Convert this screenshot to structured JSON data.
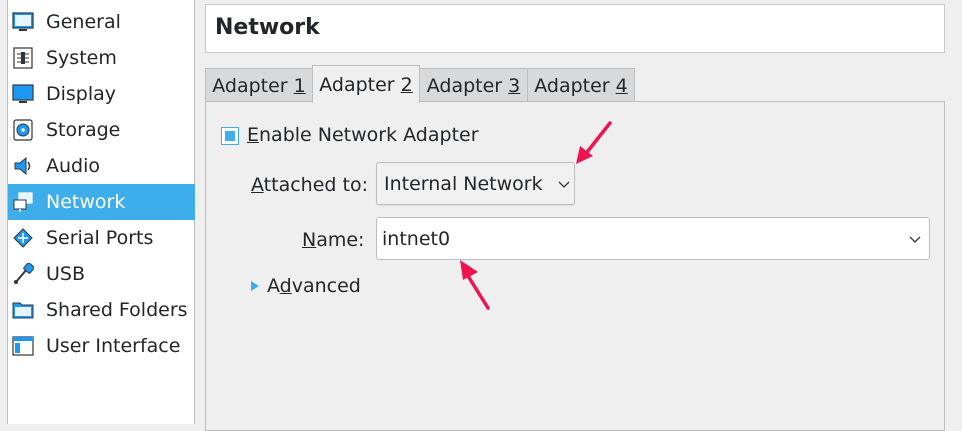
{
  "sidebar": {
    "items": [
      {
        "label": "General",
        "icon": "general-icon"
      },
      {
        "label": "System",
        "icon": "system-icon"
      },
      {
        "label": "Display",
        "icon": "display-icon"
      },
      {
        "label": "Storage",
        "icon": "storage-icon"
      },
      {
        "label": "Audio",
        "icon": "audio-icon"
      },
      {
        "label": "Network",
        "icon": "network-icon",
        "selected": true
      },
      {
        "label": "Serial Ports",
        "icon": "serial-ports-icon"
      },
      {
        "label": "USB",
        "icon": "usb-icon"
      },
      {
        "label": "Shared Folders",
        "icon": "shared-folders-icon"
      },
      {
        "label": "User Interface",
        "icon": "user-interface-icon"
      }
    ]
  },
  "header": {
    "title": "Network"
  },
  "tabs": [
    {
      "label": "Adapter ",
      "mnemonic": "1"
    },
    {
      "label": "Adapter ",
      "mnemonic": "2",
      "active": true
    },
    {
      "label": "Adapter ",
      "mnemonic": "3"
    },
    {
      "label": "Adapter ",
      "mnemonic": "4"
    }
  ],
  "adapter": {
    "enable_mnemonic": "E",
    "enable_rest": "nable Network Adapter",
    "enable_checked": true,
    "attached_mnemonic": "A",
    "attached_rest": "ttached to:",
    "attached_value": "Internal Network",
    "name_mnemonic": "N",
    "name_rest": "ame:",
    "name_value": "intnet0",
    "advanced_pre": "A",
    "advanced_mnemonic": "d",
    "advanced_rest": "vanced"
  },
  "colors": {
    "accent": "#3daee9",
    "annotation_arrow": "#f0134f",
    "background": "#efefef"
  }
}
